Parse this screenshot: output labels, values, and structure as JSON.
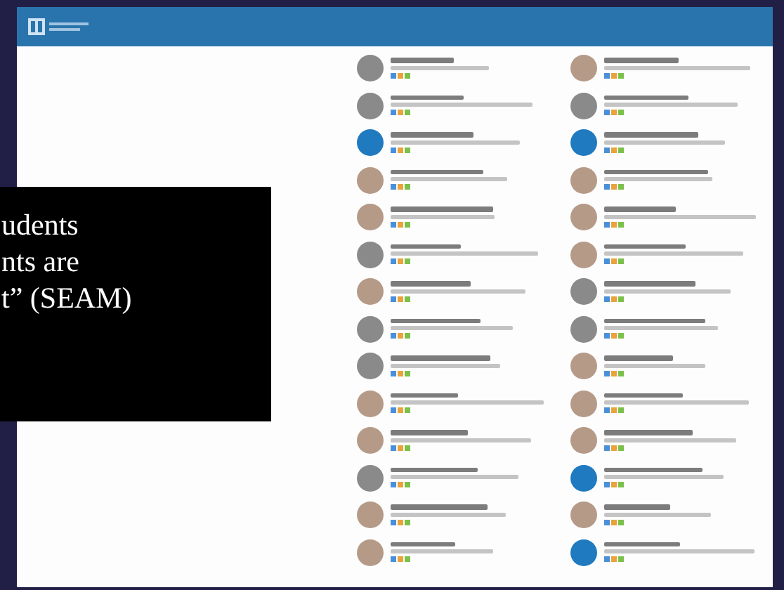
{
  "overlay": {
    "lines": [
      "udents",
      "nts are",
      "t” (SEAM)"
    ]
  },
  "directory": {
    "columns": [
      {
        "people": [
          {
            "kind": "silhouette"
          },
          {
            "kind": "silhouette"
          },
          {
            "kind": "default"
          },
          {
            "kind": "photo"
          },
          {
            "kind": "photo"
          },
          {
            "kind": "silhouette"
          },
          {
            "kind": "photo"
          },
          {
            "kind": "silhouette"
          },
          {
            "kind": "silhouette"
          },
          {
            "kind": "photo"
          },
          {
            "kind": "photo"
          },
          {
            "kind": "silhouette"
          },
          {
            "kind": "photo"
          },
          {
            "kind": "photo"
          }
        ]
      },
      {
        "people": [
          {
            "kind": "photo"
          },
          {
            "kind": "silhouette"
          },
          {
            "kind": "default"
          },
          {
            "kind": "photo"
          },
          {
            "kind": "photo"
          },
          {
            "kind": "photo"
          },
          {
            "kind": "silhouette"
          },
          {
            "kind": "silhouette"
          },
          {
            "kind": "photo"
          },
          {
            "kind": "photo"
          },
          {
            "kind": "photo"
          },
          {
            "kind": "default"
          },
          {
            "kind": "photo"
          },
          {
            "kind": "default"
          }
        ]
      }
    ]
  }
}
